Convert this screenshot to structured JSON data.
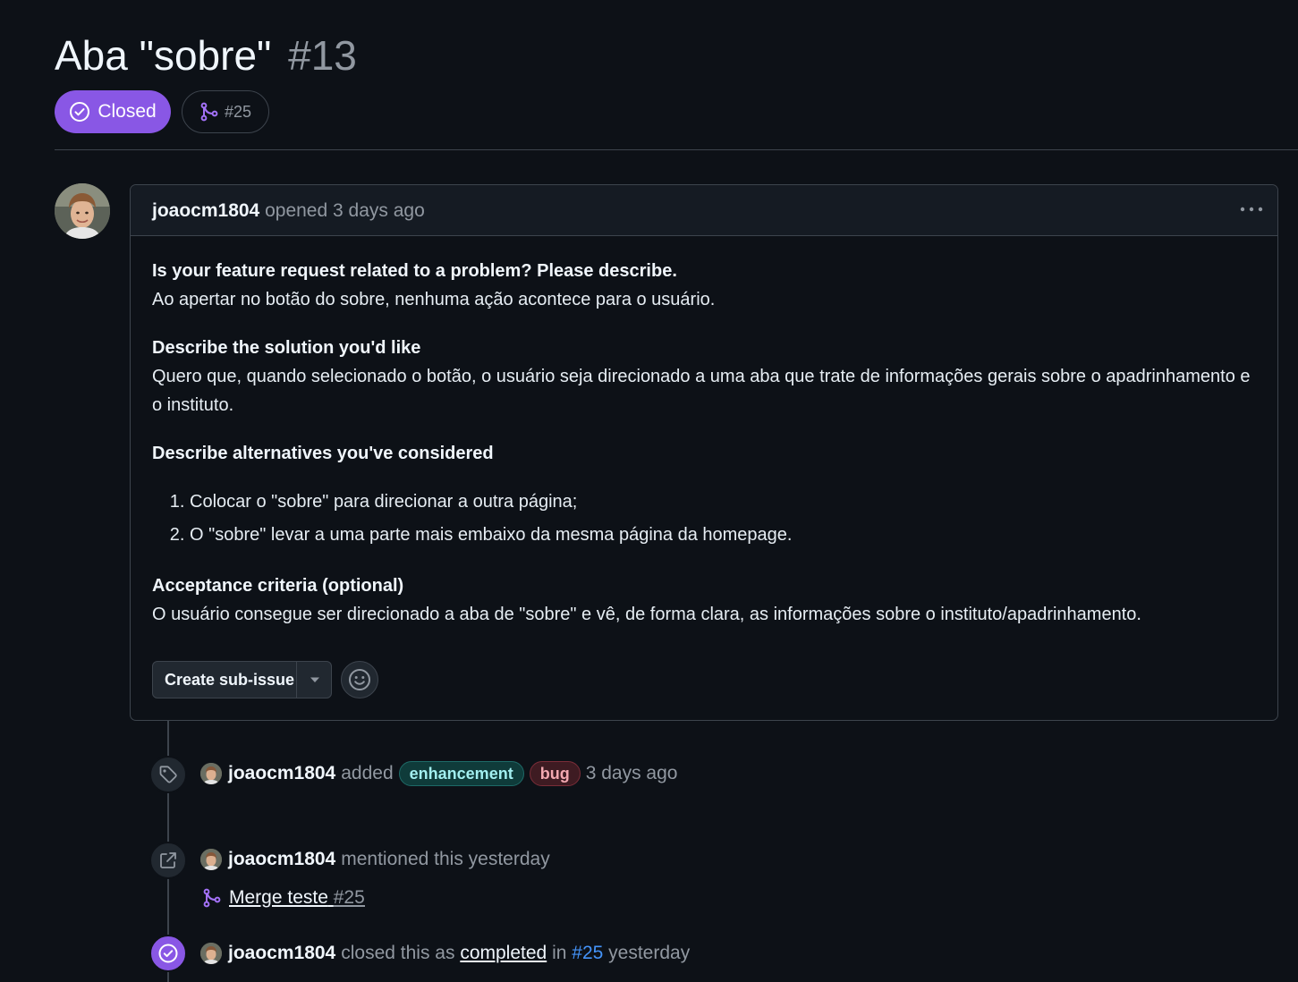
{
  "issue": {
    "title": "Aba \"sobre\"",
    "number": "#13",
    "state_label": "Closed",
    "linked_pr": "#25"
  },
  "comment": {
    "author": "joaocm1804",
    "action": "opened 3 days ago",
    "sections": [
      {
        "heading": "Is your feature request related to a problem? Please describe.",
        "text": "Ao apertar no botão do sobre, nenhuma ação acontece para o usuário."
      },
      {
        "heading": "Describe the solution you'd like",
        "text": "Quero que, quando selecionado o botão, o usuário seja direcionado a uma aba que trate de informações gerais sobre o apadrinhamento e o instituto."
      },
      {
        "heading": "Describe alternatives you've considered",
        "items": [
          "Colocar o \"sobre\" para direcionar a outra página;",
          "O \"sobre\" levar a uma parte mais embaixo da mesma página da homepage."
        ]
      },
      {
        "heading": "Acceptance criteria (optional)",
        "text": "O usuário consegue ser direcionado a aba de \"sobre\" e vê, de forma clara, as informações sobre o instituto/apadrinhamento."
      }
    ],
    "create_sub_issue_label": "Create sub-issue"
  },
  "timeline": {
    "labeled": {
      "author": "joaocm1804",
      "verb": "added",
      "labels": [
        "enhancement",
        "bug"
      ],
      "time": "3 days ago"
    },
    "mentioned": {
      "author": "joaocm1804",
      "text": "mentioned this yesterday",
      "ref_title": "Merge teste",
      "ref_number": "#25"
    },
    "closed": {
      "author": "joaocm1804",
      "prefix": "closed this as",
      "reason": "completed",
      "in": "in",
      "pr": "#25",
      "time": "yesterday"
    }
  },
  "colors": {
    "background": "#0d1117",
    "closed_purple": "#8957e5",
    "border": "#3d444d",
    "link_blue": "#4493f8"
  },
  "icons": [
    "check-circle-icon",
    "git-merge-icon",
    "kebab-icon",
    "triangle-down-icon",
    "smiley-icon",
    "tag-icon",
    "cross-reference-icon"
  ]
}
